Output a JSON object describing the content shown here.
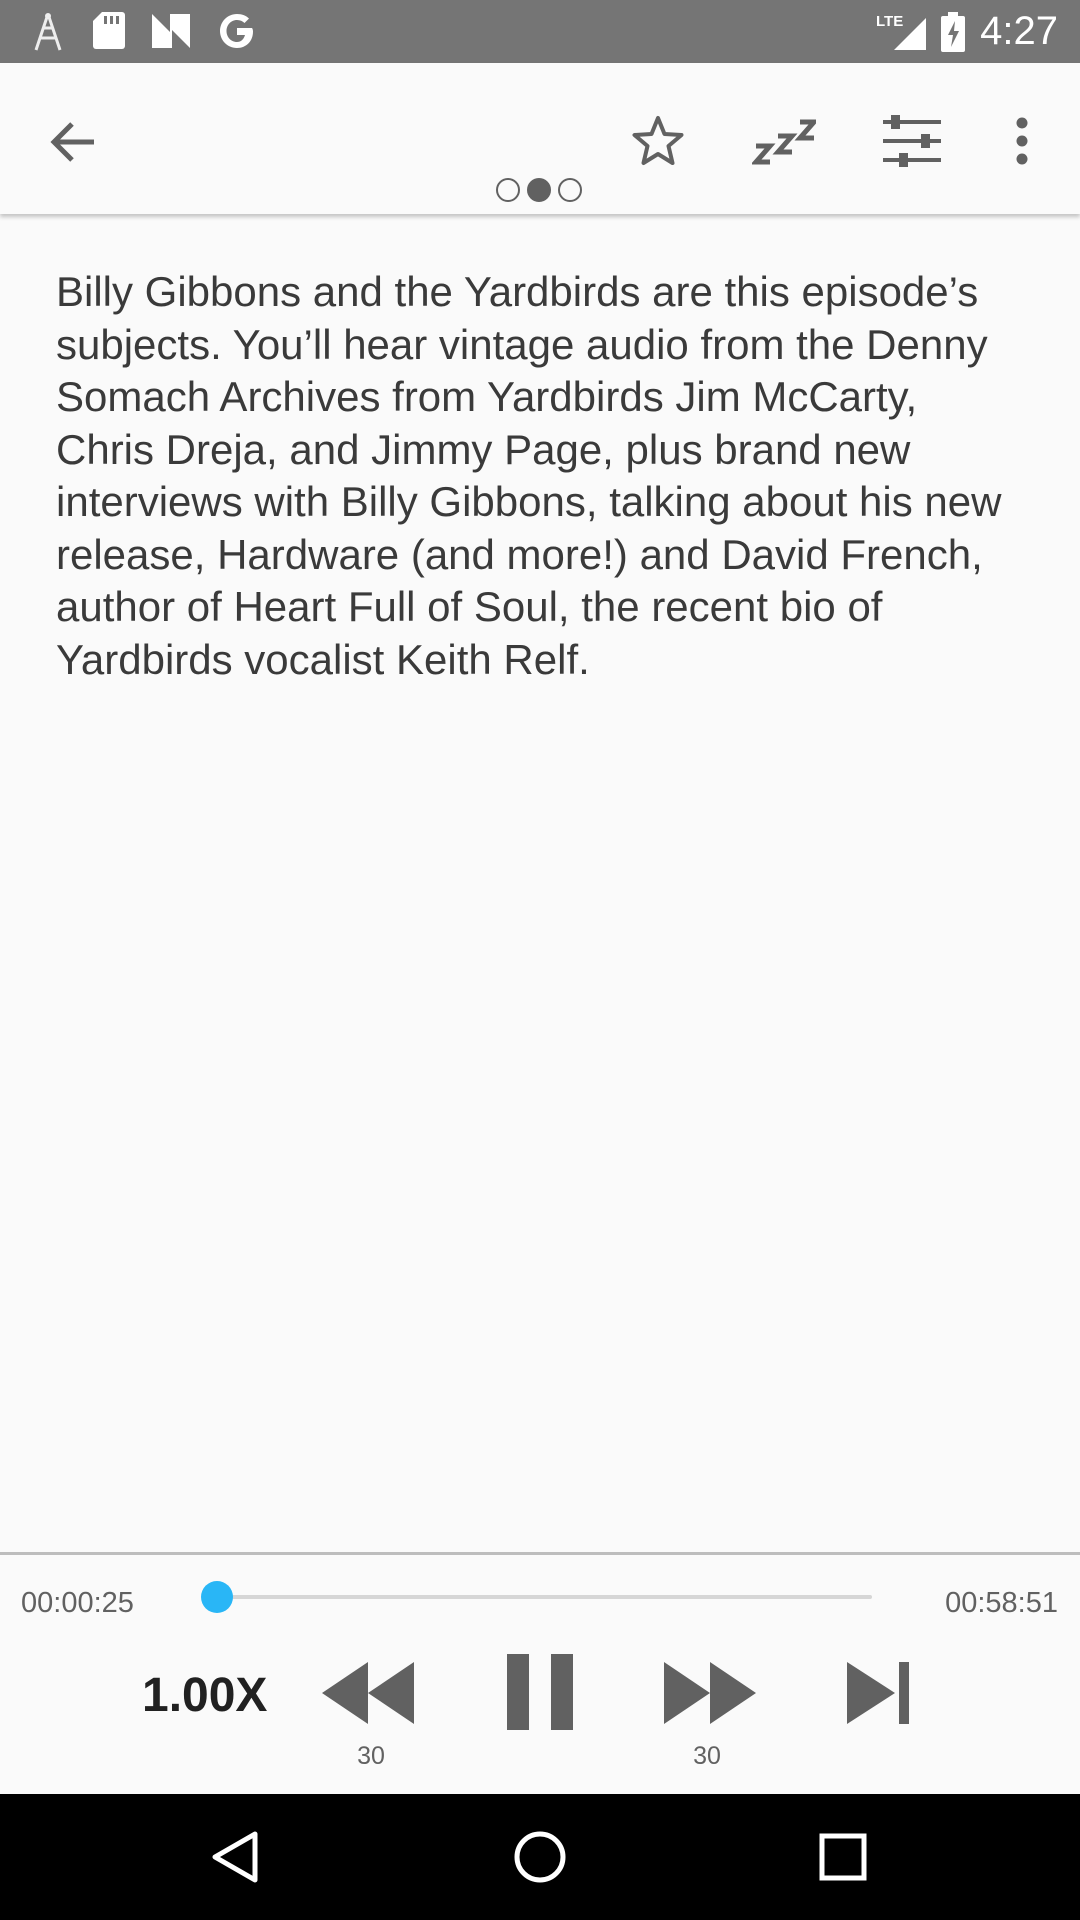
{
  "status_bar": {
    "time": "4:27",
    "network": "LTE",
    "icons": [
      "antenna-icon",
      "sd-card-icon",
      "n-app-icon",
      "google-icon",
      "signal-icon",
      "battery-icon"
    ]
  },
  "toolbar": {
    "icons": [
      "back-arrow-icon",
      "star-icon",
      "sleep-timer-icon",
      "equalizer-icon",
      "more-vert-icon"
    ],
    "page_indicator": {
      "count": 3,
      "active_index": 1
    }
  },
  "episode": {
    "description": "Billy Gibbons and the Yardbirds are this episode’s subjects. You’ll hear vintage audio from the Denny Somach Archives from Yardbirds Jim McCarty, Chris Dreja, and Jimmy Page, plus brand new interviews with Billy Gibbons, talking about his new release, Hardware (and more!) and David French, author of Heart Full of Soul, the recent bio of Yardbirds vocalist Keith Relf."
  },
  "player": {
    "elapsed": "00:00:25",
    "duration": "00:58:51",
    "progress_fraction": 0.007,
    "speed": "1.00X",
    "rewind_seconds": "30",
    "forward_seconds": "30",
    "accent_color": "#29b6f6",
    "icons": [
      "rewind-icon",
      "pause-icon",
      "fast-forward-icon",
      "skip-next-icon"
    ]
  },
  "nav_bar": {
    "icons": [
      "back-triangle-icon",
      "home-circle-icon",
      "recents-square-icon"
    ]
  }
}
